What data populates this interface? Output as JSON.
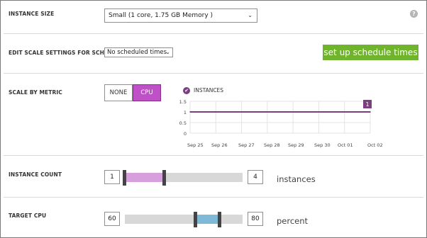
{
  "instance_size": {
    "label": "INSTANCE SIZE",
    "value": "Small (1 core, 1.75 GB Memory )",
    "help_icon": "?"
  },
  "schedule": {
    "label": "EDIT SCALE SETTINGS FOR SCHEDULE",
    "value": "No scheduled times",
    "button_label": "set up schedule times"
  },
  "metric": {
    "label": "SCALE BY METRIC",
    "options": [
      "NONE",
      "CPU"
    ],
    "selected": "CPU",
    "legend_check": "✔",
    "legend_label": "INSTANCES"
  },
  "chart_data": {
    "type": "line",
    "series": [
      {
        "name": "INSTANCES",
        "x": [
          "Sep 25",
          "Sep 26",
          "Sep 27",
          "Sep 28",
          "Sep 29",
          "Sep 30",
          "Oct 01",
          "Oct 02"
        ],
        "values": [
          1,
          1,
          1,
          1,
          1,
          1,
          1,
          1
        ]
      }
    ],
    "y_ticks": [
      "1.5",
      "1",
      "0.5",
      "0"
    ],
    "x_ticks": [
      "Sep 25",
      "Sep 26",
      "Sep 27",
      "Sep 28",
      "Sep 29",
      "Sep 30",
      "Oct 01",
      "Oct 02"
    ],
    "ylim": [
      0,
      1.5
    ],
    "end_badge": "1",
    "grid": true
  },
  "instance_count": {
    "label": "INSTANCE COUNT",
    "min": "1",
    "max": "4",
    "unit": "instances",
    "range_low": 1,
    "range_high": 2,
    "scale_min": 1,
    "scale_max": 4
  },
  "target_cpu": {
    "label": "TARGET CPU",
    "min": "60",
    "max": "80",
    "unit": "percent",
    "range_low": 60,
    "range_high": 80,
    "scale_min": 0,
    "scale_max": 100
  },
  "colors": {
    "accent_purple": "#c050c8",
    "range_purple": "#d7a0dd",
    "range_blue": "#7fb9d8",
    "button_green": "#6fb42c",
    "series_line": "#7b3f7f"
  }
}
